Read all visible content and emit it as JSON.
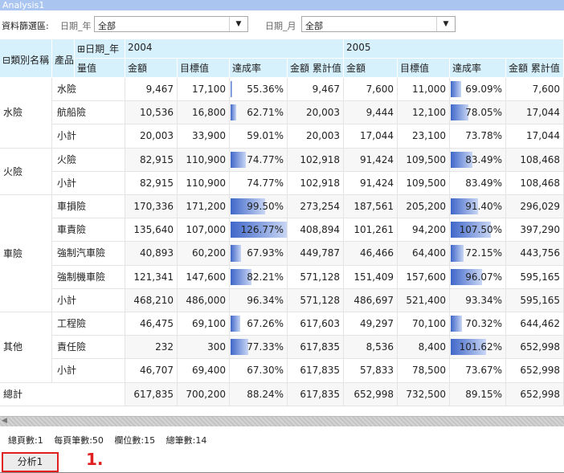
{
  "window": {
    "title": "Analysis1"
  },
  "filters": {
    "label": "資料篩選區:",
    "year_label": "日期_年",
    "year_value": "全部",
    "month_label": "日期_月",
    "month_value": "全部"
  },
  "pivot": {
    "corner_label": "產品",
    "category_header": "類別名稱",
    "year_field": "日期_年",
    "measure_header": "量值",
    "years": [
      "2004",
      "2005"
    ],
    "measures": [
      "金額",
      "目標值",
      "達成率",
      "金額 累計值"
    ],
    "rows": [
      {
        "cat": "水險",
        "prod": "水險",
        "v": [
          "9,467",
          "17,100",
          "55.36%",
          "9,467",
          "7,600",
          "11,000",
          "69.09%",
          "7,600"
        ],
        "r": [
          0.5536,
          0.6909
        ]
      },
      {
        "cat": "",
        "prod": "航船險",
        "v": [
          "10,536",
          "16,800",
          "62.71%",
          "20,003",
          "9,444",
          "12,100",
          "78.05%",
          "17,044"
        ],
        "r": [
          0.6271,
          0.7805
        ]
      },
      {
        "cat": "",
        "prod": "小計",
        "v": [
          "20,003",
          "33,900",
          "59.01%",
          "20,003",
          "17,044",
          "23,100",
          "73.78%",
          "17,044"
        ],
        "r": [
          0,
          0
        ]
      },
      {
        "cat": "火險",
        "prod": "火險",
        "v": [
          "82,915",
          "110,900",
          "74.77%",
          "102,918",
          "91,424",
          "109,500",
          "83.49%",
          "108,468"
        ],
        "r": [
          0.7477,
          0.8349
        ]
      },
      {
        "cat": "",
        "prod": "小計",
        "v": [
          "82,915",
          "110,900",
          "74.77%",
          "102,918",
          "91,424",
          "109,500",
          "83.49%",
          "108,468"
        ],
        "r": [
          0,
          0
        ]
      },
      {
        "cat": "車險",
        "prod": "車損險",
        "v": [
          "170,336",
          "171,200",
          "99.50%",
          "273,254",
          "187,561",
          "205,200",
          "91.40%",
          "296,029"
        ],
        "r": [
          0.995,
          0.914
        ]
      },
      {
        "cat": "",
        "prod": "車責險",
        "v": [
          "135,640",
          "107,000",
          "126.77%",
          "408,894",
          "101,261",
          "94,200",
          "107.50%",
          "397,290"
        ],
        "r": [
          1.2677,
          1.075
        ]
      },
      {
        "cat": "",
        "prod": "強制汽車險",
        "v": [
          "40,893",
          "60,200",
          "67.93%",
          "449,787",
          "46,466",
          "64,400",
          "72.15%",
          "443,756"
        ],
        "r": [
          0.6793,
          0.7215
        ]
      },
      {
        "cat": "",
        "prod": "強制機車險",
        "v": [
          "121,341",
          "147,600",
          "82.21%",
          "571,128",
          "151,409",
          "157,600",
          "96.07%",
          "595,165"
        ],
        "r": [
          0.8221,
          0.9607
        ]
      },
      {
        "cat": "",
        "prod": "小計",
        "v": [
          "468,210",
          "486,000",
          "96.34%",
          "571,128",
          "486,697",
          "521,400",
          "93.34%",
          "595,165"
        ],
        "r": [
          0,
          0
        ]
      },
      {
        "cat": "其他",
        "prod": "工程險",
        "v": [
          "46,475",
          "69,100",
          "67.26%",
          "617,603",
          "49,297",
          "70,100",
          "70.32%",
          "644,462"
        ],
        "r": [
          0.6726,
          0.7032
        ]
      },
      {
        "cat": "",
        "prod": "責任險",
        "v": [
          "232",
          "300",
          "77.33%",
          "617,835",
          "8,536",
          "8,400",
          "101.62%",
          "652,998"
        ],
        "r": [
          0.7733,
          1.0162
        ]
      },
      {
        "cat": "",
        "prod": "小計",
        "v": [
          "46,707",
          "69,400",
          "67.30%",
          "617,835",
          "57,833",
          "78,500",
          "73.67%",
          "652,998"
        ],
        "r": [
          0,
          0
        ]
      },
      {
        "cat": "總計",
        "prod": "",
        "v": [
          "617,835",
          "700,200",
          "88.24%",
          "617,835",
          "652,998",
          "732,500",
          "89.15%",
          "652,998"
        ],
        "r": [
          0,
          0
        ]
      }
    ]
  },
  "footer": {
    "total_pages": "總頁數:1",
    "per_page": "每頁筆數:50",
    "columns": "欄位數:15",
    "total_records": "總筆數:14"
  },
  "tabs": [
    {
      "label": "分析1"
    }
  ],
  "annotation": "1."
}
